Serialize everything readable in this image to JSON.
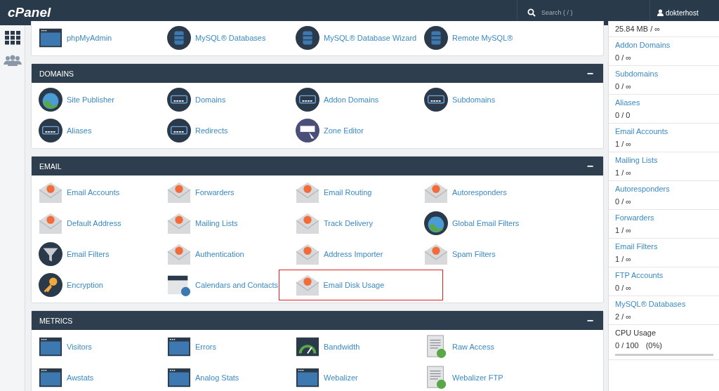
{
  "topbar": {
    "logo": "cPanel",
    "search": {
      "placeholder": "Search ( / )"
    },
    "user": "dokterhost"
  },
  "sections": [
    {
      "items": [
        {
          "label": "phpMyAdmin",
          "kind": "window",
          "highlighted": false
        },
        {
          "label": "MySQL® Databases",
          "kind": "database",
          "highlighted": false
        },
        {
          "label": "MySQL® Database Wizard",
          "kind": "database",
          "highlighted": false
        },
        {
          "label": "Remote MySQL®",
          "kind": "database",
          "highlighted": false
        }
      ]
    },
    {
      "title": "DOMAINS",
      "collapse": "−",
      "items": [
        {
          "label": "Site Publisher",
          "kind": "globe",
          "highlighted": false
        },
        {
          "label": "Domains",
          "kind": "domain",
          "highlighted": false
        },
        {
          "label": "Addon Domains",
          "kind": "domain",
          "highlighted": false
        },
        {
          "label": "Subdomains",
          "kind": "domain",
          "highlighted": false
        },
        {
          "label": "Aliases",
          "kind": "domain",
          "highlighted": false
        },
        {
          "label": "Redirects",
          "kind": "domain",
          "highlighted": false
        },
        {
          "label": "Zone Editor",
          "kind": "dns",
          "highlighted": false
        }
      ]
    },
    {
      "title": "EMAIL",
      "collapse": "−",
      "items": [
        {
          "label": "Email Accounts",
          "kind": "envelope",
          "highlighted": false
        },
        {
          "label": "Forwarders",
          "kind": "envelope",
          "highlighted": false
        },
        {
          "label": "Email Routing",
          "kind": "envelope",
          "highlighted": false
        },
        {
          "label": "Autoresponders",
          "kind": "envelope",
          "highlighted": false
        },
        {
          "label": "Default Address",
          "kind": "envelope",
          "highlighted": false
        },
        {
          "label": "Mailing Lists",
          "kind": "envelope",
          "highlighted": false
        },
        {
          "label": "Track Delivery",
          "kind": "envelope",
          "highlighted": false
        },
        {
          "label": "Global Email Filters",
          "kind": "globe",
          "highlighted": false
        },
        {
          "label": "Email Filters",
          "kind": "filter",
          "highlighted": false
        },
        {
          "label": "Authentication",
          "kind": "envelope",
          "highlighted": false
        },
        {
          "label": "Address Importer",
          "kind": "envelope",
          "highlighted": false
        },
        {
          "label": "Spam Filters",
          "kind": "envelope",
          "highlighted": false
        },
        {
          "label": "Encryption",
          "kind": "key",
          "highlighted": false
        },
        {
          "label": "Calendars and Contacts",
          "kind": "calendar",
          "highlighted": false
        },
        {
          "label": "Email Disk Usage",
          "kind": "envelope",
          "highlighted": true
        }
      ]
    },
    {
      "title": "METRICS",
      "collapse": "−",
      "items": [
        {
          "label": "Visitors",
          "kind": "window",
          "highlighted": false
        },
        {
          "label": "Errors",
          "kind": "window",
          "highlighted": false
        },
        {
          "label": "Bandwidth",
          "kind": "gauge",
          "highlighted": false
        },
        {
          "label": "Raw Access",
          "kind": "document",
          "highlighted": false
        },
        {
          "label": "Awstats",
          "kind": "window",
          "highlighted": false
        },
        {
          "label": "Analog Stats",
          "kind": "window",
          "highlighted": false
        },
        {
          "label": "Webalizer",
          "kind": "window",
          "highlighted": false
        },
        {
          "label": "Webalizer FTP",
          "kind": "document",
          "highlighted": false
        }
      ]
    }
  ],
  "stats": [
    {
      "value": "25.84 MB / ∞",
      "kind": "link"
    },
    {
      "label": "Addon Domains",
      "value": "0 / ∞",
      "kind": "link"
    },
    {
      "label": "Subdomains",
      "value": "0 / ∞",
      "kind": "link"
    },
    {
      "label": "Aliases",
      "value": "0 / 0",
      "kind": "link"
    },
    {
      "label": "Email Accounts",
      "value": "1 / ∞",
      "kind": "link"
    },
    {
      "label": "Mailing Lists",
      "value": "1 / ∞",
      "kind": "link"
    },
    {
      "label": "Autoresponders",
      "value": "0 / ∞",
      "kind": "link"
    },
    {
      "label": "Forwarders",
      "value": "1 / ∞",
      "kind": "link"
    },
    {
      "label": "Email Filters",
      "value": "1 / ∞",
      "kind": "link"
    },
    {
      "label": "FTP Accounts",
      "value": "0 / ∞",
      "kind": "link"
    },
    {
      "label": "MySQL® Databases",
      "value": "2 / ∞",
      "kind": "link"
    },
    {
      "label": "CPU Usage",
      "value": "0 / 100",
      "percent": "(0%)",
      "kind": "meter"
    }
  ]
}
